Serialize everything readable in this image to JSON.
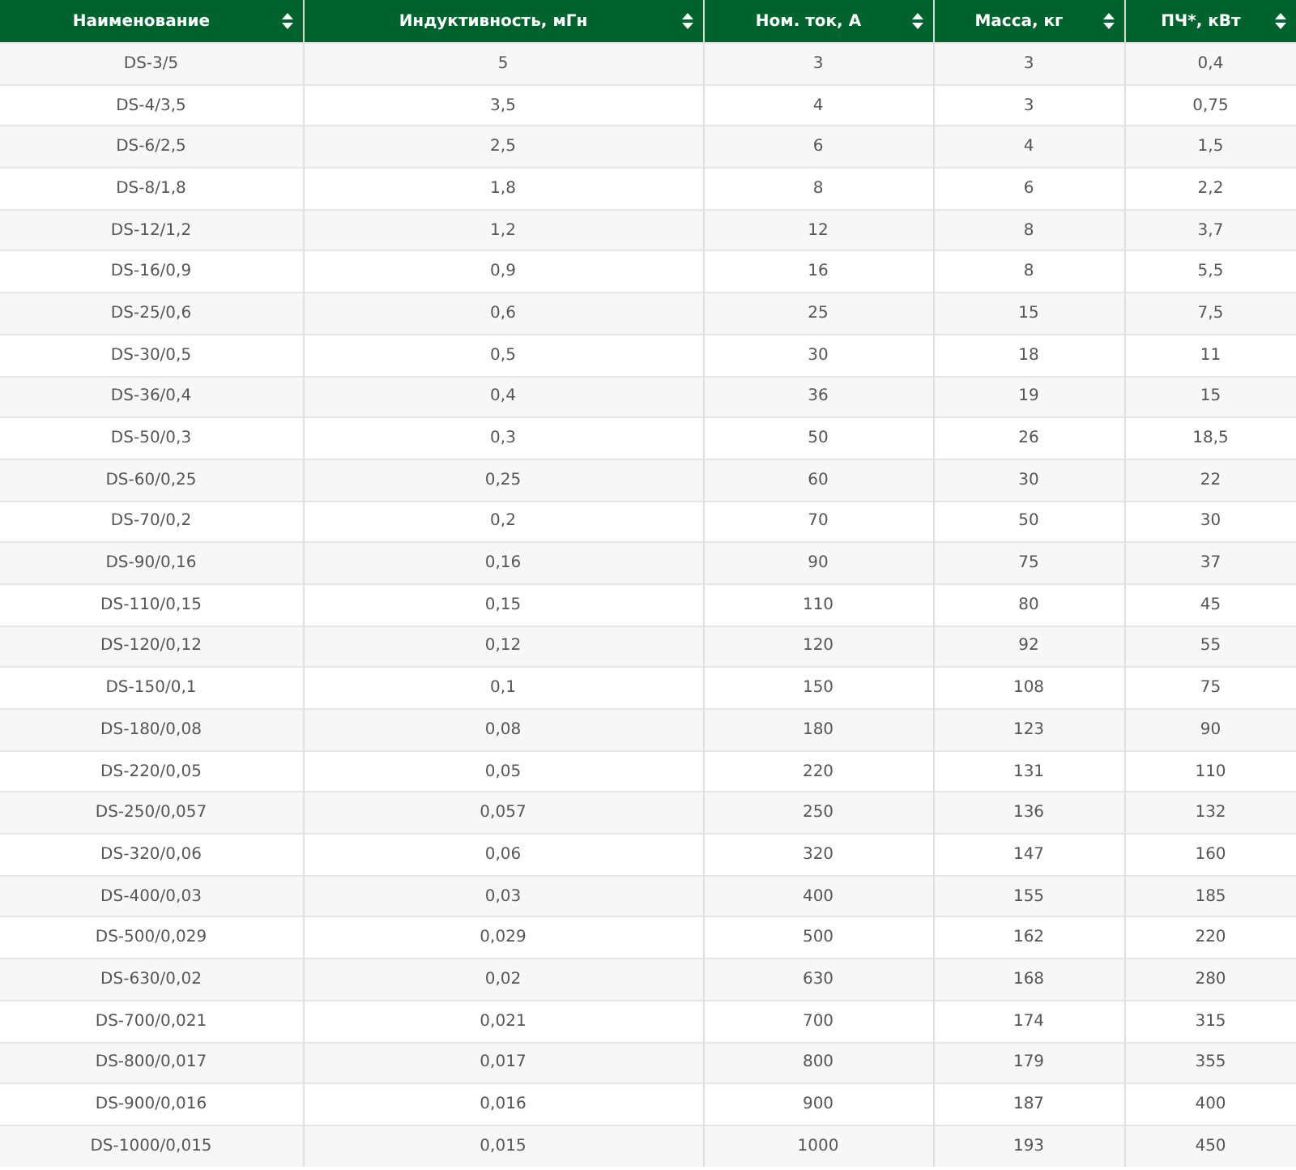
{
  "table": {
    "columns": [
      "Наименование",
      "Индуктивность, мГн",
      "Ном. ток, А",
      "Масса, кг",
      "ПЧ*, кВт"
    ],
    "rows": [
      [
        "DS-3/5",
        "5",
        "3",
        "3",
        "0,4"
      ],
      [
        "DS-4/3,5",
        "3,5",
        "4",
        "3",
        "0,75"
      ],
      [
        "DS-6/2,5",
        "2,5",
        "6",
        "4",
        "1,5"
      ],
      [
        "DS-8/1,8",
        "1,8",
        "8",
        "6",
        "2,2"
      ],
      [
        "DS-12/1,2",
        "1,2",
        "12",
        "8",
        "3,7"
      ],
      [
        "DS-16/0,9",
        "0,9",
        "16",
        "8",
        "5,5"
      ],
      [
        "DS-25/0,6",
        "0,6",
        "25",
        "15",
        "7,5"
      ],
      [
        "DS-30/0,5",
        "0,5",
        "30",
        "18",
        "11"
      ],
      [
        "DS-36/0,4",
        "0,4",
        "36",
        "19",
        "15"
      ],
      [
        "DS-50/0,3",
        "0,3",
        "50",
        "26",
        "18,5"
      ],
      [
        "DS-60/0,25",
        "0,25",
        "60",
        "30",
        "22"
      ],
      [
        "DS-70/0,2",
        "0,2",
        "70",
        "50",
        "30"
      ],
      [
        "DS-90/0,16",
        "0,16",
        "90",
        "75",
        "37"
      ],
      [
        "DS-110/0,15",
        "0,15",
        "110",
        "80",
        "45"
      ],
      [
        "DS-120/0,12",
        "0,12",
        "120",
        "92",
        "55"
      ],
      [
        "DS-150/0,1",
        "0,1",
        "150",
        "108",
        "75"
      ],
      [
        "DS-180/0,08",
        "0,08",
        "180",
        "123",
        "90"
      ],
      [
        "DS-220/0,05",
        "0,05",
        "220",
        "131",
        "110"
      ],
      [
        "DS-250/0,057",
        "0,057",
        "250",
        "136",
        "132"
      ],
      [
        "DS-320/0,06",
        "0,06",
        "320",
        "147",
        "160"
      ],
      [
        "DS-400/0,03",
        "0,03",
        "400",
        "155",
        "185"
      ],
      [
        "DS-500/0,029",
        "0,029",
        "500",
        "162",
        "220"
      ],
      [
        "DS-630/0,02",
        "0,02",
        "630",
        "168",
        "280"
      ],
      [
        "DS-700/0,021",
        "0,021",
        "700",
        "174",
        "315"
      ],
      [
        "DS-800/0,017",
        "0,017",
        "800",
        "179",
        "355"
      ],
      [
        "DS-900/0,016",
        "0,016",
        "900",
        "187",
        "400"
      ],
      [
        "DS-1000/0,015",
        "0,015",
        "1000",
        "193",
        "450"
      ]
    ]
  }
}
